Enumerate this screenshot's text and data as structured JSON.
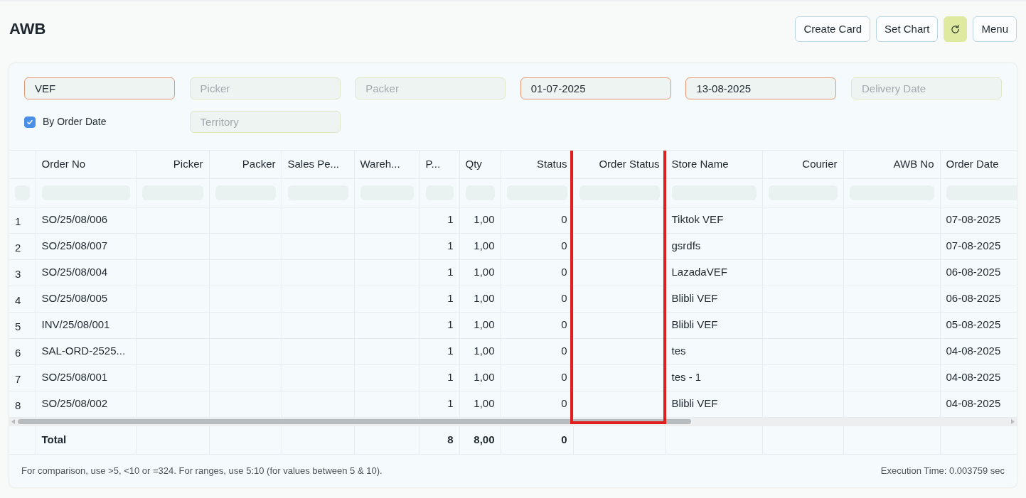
{
  "page_title": "AWB",
  "toolbar": {
    "buttons": [
      "Create Card",
      "Set Chart"
    ],
    "menu": "Menu"
  },
  "filters": [
    {
      "value": "VEF"
    },
    {
      "placeholder": "Picker"
    },
    {
      "placeholder": "Packer"
    },
    {
      "value": "01-07-2025"
    },
    {
      "value": "13-08-2025"
    },
    {
      "placeholder": "Delivery Date"
    }
  ],
  "by_order_date": {
    "label": "By Order Date",
    "checked": true
  },
  "territory": {
    "placeholder": "Territory"
  },
  "columns": [
    {
      "label": "Order No",
      "highlighted": false
    },
    {
      "label": "Picker",
      "highlighted": false
    },
    {
      "label": "Packer",
      "highlighted": false
    },
    {
      "label": "Sales Pe...",
      "highlighted": false
    },
    {
      "label": "Wareh...",
      "highlighted": false
    },
    {
      "label": "P...",
      "highlighted": false
    },
    {
      "label": "Qty",
      "highlighted": false
    },
    {
      "label": "Status",
      "highlighted": false
    },
    {
      "label": "Order Status",
      "highlighted": true
    },
    {
      "label": "Store Name",
      "highlighted": false
    },
    {
      "label": "Courier",
      "highlighted": false
    },
    {
      "label": "AWB No",
      "highlighted": false
    },
    {
      "label": "Order Date",
      "highlighted": false
    }
  ],
  "rows": [
    {
      "index": "1",
      "order_no": "SO/25/08/006",
      "p": "1",
      "qty": "1,00",
      "status": "0",
      "store_name": "Tiktok VEF",
      "order_date": "07-08-2025"
    },
    {
      "index": "2",
      "order_no": "SO/25/08/007",
      "p": "1",
      "qty": "1,00",
      "status": "0",
      "store_name": "gsrdfs",
      "order_date": "07-08-2025"
    },
    {
      "index": "3",
      "order_no": "SO/25/08/004",
      "p": "1",
      "qty": "1,00",
      "status": "0",
      "store_name": "LazadaVEF",
      "order_date": "06-08-2025"
    },
    {
      "index": "4",
      "order_no": "SO/25/08/005",
      "p": "1",
      "qty": "1,00",
      "status": "0",
      "store_name": "Blibli VEF",
      "order_date": "06-08-2025"
    },
    {
      "index": "5",
      "order_no": "INV/25/08/001",
      "p": "1",
      "qty": "1,00",
      "status": "0",
      "store_name": "Blibli VEF",
      "order_date": "05-08-2025"
    },
    {
      "index": "6",
      "order_no": "SAL-ORD-2525...",
      "p": "1",
      "qty": "1,00",
      "status": "0",
      "store_name": "tes",
      "order_date": "04-08-2025"
    },
    {
      "index": "7",
      "order_no": "SO/25/08/001",
      "p": "1",
      "qty": "1,00",
      "status": "0",
      "store_name": "tes - 1",
      "order_date": "04-08-2025"
    },
    {
      "index": "8",
      "order_no": "SO/25/08/002",
      "p": "1",
      "qty": "1,00",
      "status": "0",
      "store_name": "Blibli VEF",
      "order_date": "04-08-2025"
    }
  ],
  "total": {
    "order_no": "Total",
    "p": "8",
    "qty": "8,00",
    "status": "0"
  },
  "footer": {
    "hint": "For comparison, use >5, <10 or =324. For ranges, use 5:10 (for values between 5 & 10).",
    "execution_time": "Execution Time: 0.003759 sec"
  }
}
